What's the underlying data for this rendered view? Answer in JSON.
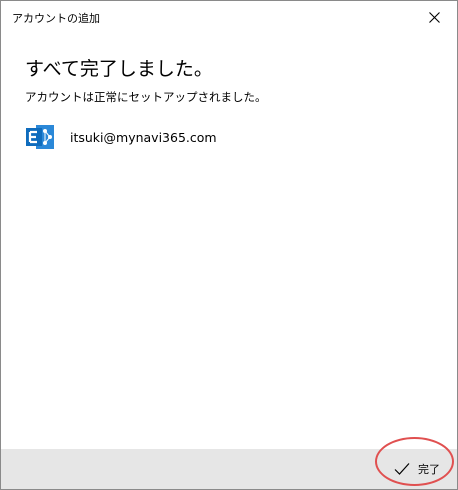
{
  "window": {
    "title": "アカウントの追加"
  },
  "main": {
    "heading": "すべて完了しました。",
    "subheading": "アカウントは正常にセットアップされました。",
    "account": {
      "icon": "exchange-icon",
      "email": "itsuki@mynavi365.com"
    }
  },
  "footer": {
    "done_label": "完了",
    "done_icon": "checkmark-icon"
  },
  "colors": {
    "exchange_blue": "#0f78d4",
    "footer_bg": "#e6e6e6",
    "highlight": "#e05050"
  }
}
